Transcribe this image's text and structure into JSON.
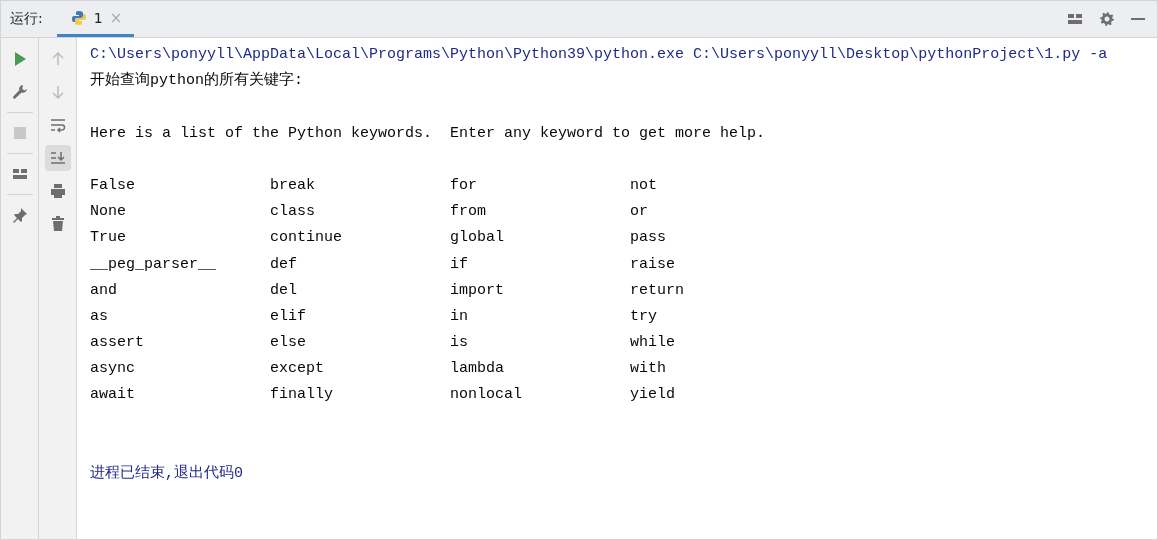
{
  "header": {
    "label": "运行:",
    "tabs": [
      {
        "label": "1",
        "close": "×",
        "selected": true
      }
    ]
  },
  "run_toolbar": [
    {
      "disabled": false
    },
    {
      "disabled": false
    },
    {
      "disabled": true
    },
    {
      "disabled": false
    },
    {
      "disabled": false
    }
  ],
  "console_toolbar": [
    {
      "disabled": true,
      "selected": false
    },
    {
      "disabled": true,
      "selected": false
    },
    {
      "disabled": false,
      "selected": false
    },
    {
      "disabled": false,
      "selected": true
    },
    {
      "disabled": false,
      "selected": false
    },
    {
      "disabled": false,
      "selected": false
    }
  ],
  "console": [
    {
      "kind": "command",
      "text": "C:\\Users\\ponyyll\\AppData\\Local\\Programs\\Python\\Python39\\python.exe C:\\Users\\ponyyll\\Desktop\\pythonProject\\1.py -a"
    },
    {
      "kind": "output",
      "text": "开始查询python的所有关键字:"
    },
    {
      "kind": "blank"
    },
    {
      "kind": "output",
      "text": "Here is a list of the Python keywords.  Enter any keyword to get more help."
    },
    {
      "kind": "blank"
    },
    {
      "kind": "columns",
      "cells": [
        "False",
        "break",
        "for",
        "not"
      ]
    },
    {
      "kind": "columns",
      "cells": [
        "None",
        "class",
        "from",
        "or"
      ]
    },
    {
      "kind": "columns",
      "cells": [
        "True",
        "continue",
        "global",
        "pass"
      ]
    },
    {
      "kind": "columns",
      "cells": [
        "__peg_parser__",
        "def",
        "if",
        "raise"
      ]
    },
    {
      "kind": "columns",
      "cells": [
        "and",
        "del",
        "import",
        "return"
      ]
    },
    {
      "kind": "columns",
      "cells": [
        "as",
        "elif",
        "in",
        "try"
      ]
    },
    {
      "kind": "columns",
      "cells": [
        "assert",
        "else",
        "is",
        "while"
      ]
    },
    {
      "kind": "columns",
      "cells": [
        "async",
        "except",
        "lambda",
        "with"
      ]
    },
    {
      "kind": "columns",
      "cells": [
        "await",
        "finally",
        "nonlocal",
        "yield"
      ]
    },
    {
      "kind": "blank"
    },
    {
      "kind": "blank"
    },
    {
      "kind": "exit",
      "text": "进程已结束,退出代码0"
    }
  ]
}
